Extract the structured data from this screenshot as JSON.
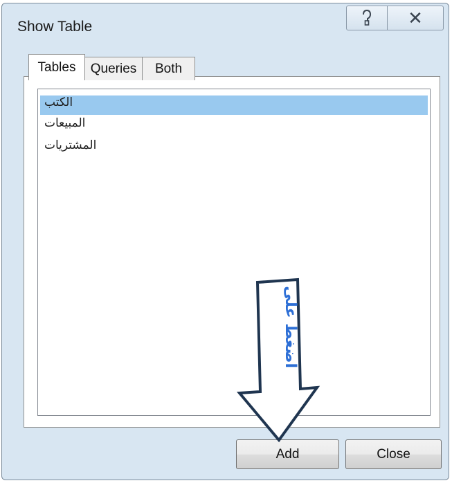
{
  "window": {
    "title": "Show Table",
    "help_glyph": "?",
    "close_glyph": "✕"
  },
  "tabs": [
    {
      "label": "Tables",
      "active": true
    },
    {
      "label": "Queries",
      "active": false
    },
    {
      "label": "Both",
      "active": false
    }
  ],
  "table_list": {
    "items": [
      {
        "label": "الكتب",
        "selected": true
      },
      {
        "label": "المبيعات",
        "selected": false
      },
      {
        "label": "المشتريات",
        "selected": false
      }
    ]
  },
  "buttons": {
    "add_label": "Add",
    "close_label": "Close"
  },
  "annotation": {
    "text": "اضغط على",
    "color": "#2d6fd6"
  }
}
